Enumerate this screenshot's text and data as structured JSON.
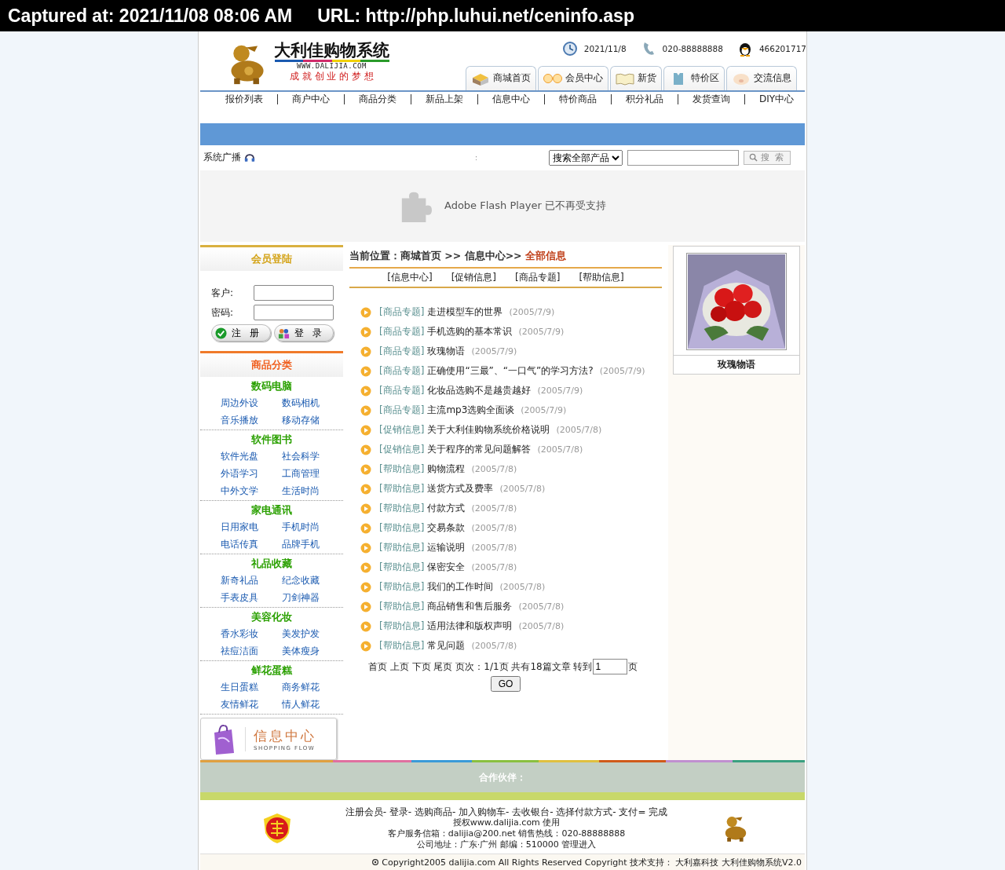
{
  "capture_bar": {
    "captured": "Captured at: 2021/11/08 08:06 AM",
    "url": "URL: http://php.luhui.net/ceninfo.asp"
  },
  "header": {
    "logo_title": "大利佳购物系统",
    "logo_url": "WWW.DALIJIA.COM",
    "slogan": "成 就 创 业 的 梦 想",
    "date": "2021/11/8",
    "phone": "020-88888888",
    "qq": "466201717",
    "tabs": [
      {
        "label": "商城首页",
        "kind": "box"
      },
      {
        "label": "会员中心",
        "kind": "smile"
      },
      {
        "label": "新货",
        "kind": "book"
      },
      {
        "label": "特价区",
        "kind": "shirt"
      },
      {
        "label": "交流信息",
        "kind": "pig"
      }
    ]
  },
  "nav": [
    "报价列表",
    "商户中心",
    "商品分类",
    "新品上架",
    "信息中心",
    "特价商品",
    "积分礼品",
    "发货查询",
    "DIY中心"
  ],
  "broadcast": {
    "label": "系统广播",
    "ticker": ":"
  },
  "search": {
    "category": "搜索全部产品",
    "button": "搜 索"
  },
  "flash_notice": "Adobe Flash Player 已不再受支持",
  "login": {
    "title": "会员登陆",
    "fields": [
      {
        "label": "客户:"
      },
      {
        "label": "密码:"
      }
    ],
    "register": "注 册",
    "login": "登 录"
  },
  "categories": {
    "title": "商品分类",
    "groups": [
      {
        "name": "数码电脑",
        "items": [
          "周边外设",
          "数码相机",
          "音乐播放",
          "移动存储"
        ]
      },
      {
        "name": "软件图书",
        "items": [
          "软件光盘",
          "社会科学",
          "外语学习",
          "工商管理",
          "中外文学",
          "生活时尚"
        ]
      },
      {
        "name": "家电通讯",
        "items": [
          "日用家电",
          "手机时尚",
          "电话传真",
          "品牌手机"
        ]
      },
      {
        "name": "礼品收藏",
        "items": [
          "新奇礼品",
          "纪念收藏",
          "手表皮具",
          "刀剑神器"
        ]
      },
      {
        "name": "美容化妆",
        "items": [
          "香水彩妆",
          "美发护发",
          "祛痘洁面",
          "美体瘦身"
        ]
      },
      {
        "name": "鲜花蛋糕",
        "items": [
          "生日蛋糕",
          "商务鲜花",
          "友情鲜花",
          "情人鲜花"
        ]
      }
    ]
  },
  "info_banner": {
    "title": "信息中心",
    "subtitle": "SHOPPING FLOW"
  },
  "breadcrumb": {
    "path": "当前位置：商城首页 >> 信息中心>>",
    "current": "全部信息"
  },
  "subnav": [
    "[信息中心]",
    "[促销信息]",
    "[商品专题]",
    "[帮助信息]"
  ],
  "articles": [
    {
      "category": "[商品专题]",
      "title": "走进模型车的世界",
      "date": "(2005/7/9)"
    },
    {
      "category": "[商品专题]",
      "title": "手机选购的基本常识",
      "date": "(2005/7/9)"
    },
    {
      "category": "[商品专题]",
      "title": "玫瑰物语",
      "date": "(2005/7/9)"
    },
    {
      "category": "[商品专题]",
      "title": "正确使用“三最”、“一口气”的学习方法?",
      "date": "(2005/7/9)"
    },
    {
      "category": "[商品专题]",
      "title": "化妆品选购不是越贵越好",
      "date": "(2005/7/9)"
    },
    {
      "category": "[商品专题]",
      "title": "主流mp3选购全面谈",
      "date": "(2005/7/9)"
    },
    {
      "category": "[促销信息]",
      "title": "关于大利佳购物系统价格说明",
      "date": "(2005/7/8)"
    },
    {
      "category": "[促销信息]",
      "title": "关于程序的常见问题解答",
      "date": "(2005/7/8)"
    },
    {
      "category": "[帮助信息]",
      "title": "购物流程",
      "date": "(2005/7/8)"
    },
    {
      "category": "[帮助信息]",
      "title": "送货方式及费率",
      "date": "(2005/7/8)"
    },
    {
      "category": "[帮助信息]",
      "title": "付款方式",
      "date": "(2005/7/8)"
    },
    {
      "category": "[帮助信息]",
      "title": "交易条款",
      "date": "(2005/7/8)"
    },
    {
      "category": "[帮助信息]",
      "title": "运输说明",
      "date": "(2005/7/8)"
    },
    {
      "category": "[帮助信息]",
      "title": "保密安全",
      "date": "(2005/7/8)"
    },
    {
      "category": "[帮助信息]",
      "title": "我们的工作时间",
      "date": "(2005/7/8)"
    },
    {
      "category": "[帮助信息]",
      "title": "商品销售和售后服务",
      "date": "(2005/7/8)"
    },
    {
      "category": "[帮助信息]",
      "title": "适用法律和版权声明",
      "date": "(2005/7/8)"
    },
    {
      "category": "[帮助信息]",
      "title": "常见问题",
      "date": "(2005/7/8)"
    }
  ],
  "pagination": {
    "text": "首页 上页 下页 尾页 页次：1/1页 共有18篇文章 转到",
    "page": "1",
    "unit": "页",
    "go": "GO"
  },
  "product": {
    "name": "玫瑰物语"
  },
  "partners": {
    "title": "合作伙伴："
  },
  "footer": {
    "steps": "注册会员- 登录- 选购商品- 加入购物车- 去收银台- 选择付款方式- 支付= 完成",
    "lines": [
      "授权www.dalijia.com 使用",
      "客户服务信箱：dalijia@200.net 销售热线：020-88888888",
      "公司地址：广东·广州 邮编：510000 管理进入"
    ],
    "copyright": "Copyright2005 dalijia.com All Rights Reserved Copyright 技术支持：  大利嘉科技 大利佳购物系统V2.0"
  }
}
